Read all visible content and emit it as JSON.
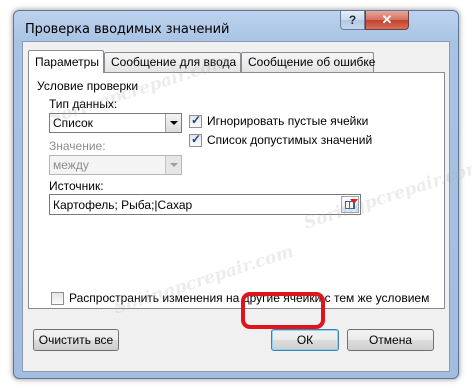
{
  "window": {
    "title": "Проверка вводимых значений",
    "help_label": "?",
    "close_label": "✕"
  },
  "tabs": [
    {
      "label": "Параметры",
      "active": true
    },
    {
      "label": "Сообщение для ввода",
      "active": false
    },
    {
      "label": "Сообщение об ошибке",
      "active": false
    }
  ],
  "params": {
    "section_title": "Условие проверки",
    "data_type_label": "Тип данных:",
    "data_type_value": "Список",
    "ignore_blank_label": "Игнорировать пустые ячейки",
    "ignore_blank_checked": true,
    "dropdown_list_label": "Список допустимых значений",
    "dropdown_list_checked": true,
    "value_label": "Значение:",
    "value_value": "между",
    "source_label": "Источник:",
    "source_value": "Картофель; Рыба;|Сахар",
    "apply_all_label": "Распространить изменения на другие ячейки с тем же условием",
    "apply_all_checked": false
  },
  "buttons": {
    "clear_all": "Очистить все",
    "ok": "ОК",
    "cancel": "Отмена"
  },
  "watermark": "Soringpcrepair.com",
  "colors": {
    "highlight": "#e0151b",
    "title_bar": "#a9c3e4",
    "close_button": "#c2412c"
  }
}
